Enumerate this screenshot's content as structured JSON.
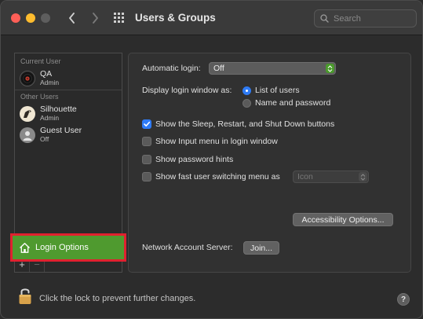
{
  "window": {
    "title": "Users & Groups"
  },
  "search": {
    "placeholder": "Search"
  },
  "sidebar": {
    "current_user_label": "Current User",
    "other_users_label": "Other Users",
    "current_user": {
      "name": "QA",
      "role": "Admin"
    },
    "other_users": [
      {
        "name": "Silhouette",
        "role": "Admin"
      },
      {
        "name": "Guest User",
        "role": "Off"
      }
    ],
    "login_options_label": "Login Options",
    "add_label": "+",
    "remove_label": "−"
  },
  "panel": {
    "automatic_login_label": "Automatic login:",
    "automatic_login_value": "Off",
    "display_login_label": "Display login window as:",
    "radio_list_of_users": "List of users",
    "radio_name_and_password": "Name and password",
    "selected_display": "List of users",
    "checkboxes": [
      {
        "label": "Show the Sleep, Restart, and Shut Down buttons",
        "checked": true
      },
      {
        "label": "Show Input menu in login window",
        "checked": false
      },
      {
        "label": "Show password hints",
        "checked": false
      },
      {
        "label": "Show fast user switching menu as",
        "checked": false
      }
    ],
    "fast_switch_value": "Icon",
    "accessibility_button": "Accessibility Options...",
    "network_server_label": "Network Account Server:",
    "join_button": "Join..."
  },
  "footer": {
    "lock_text": "Click the lock to prevent further changes.",
    "help_label": "?"
  },
  "colors": {
    "accent": "#2f7bf5",
    "highlight_box": "#e0212f",
    "login_options_bg": "#4f9a2f"
  }
}
